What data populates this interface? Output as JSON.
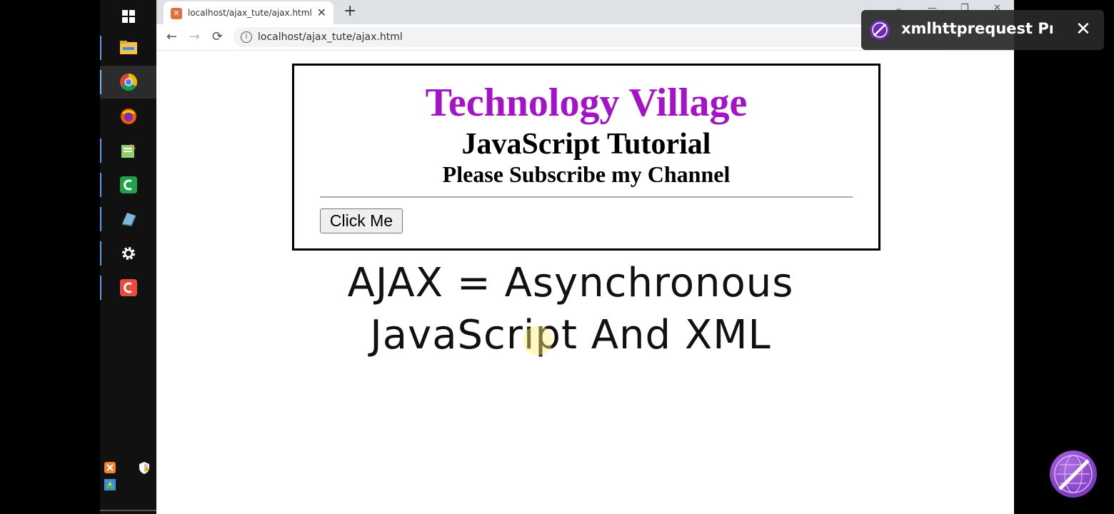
{
  "taskbar": {
    "icons": [
      "windows-icon",
      "file-explorer-icon",
      "chrome-icon",
      "firefox-icon",
      "notepad-icon",
      "camtasia-icon",
      "app-icon",
      "settings-icon",
      "camtasia-red-icon"
    ],
    "tray": [
      "xampp-icon",
      "shield-icon",
      "font-icon"
    ]
  },
  "browser": {
    "tab_title": "localhost/ajax_tute/ajax.html",
    "new_tab": "+",
    "tab_close": "✕",
    "url": "localhost/ajax_tute/ajax.html",
    "back": "←",
    "forward": "→",
    "reload": "⟳"
  },
  "page": {
    "heading1": "Technology Village",
    "heading2": "JavaScript Tutorial",
    "heading3": "Please Subscribe my Channel",
    "button_label": "Click Me",
    "caption_line1": "AJAX = Asynchronous",
    "caption_line2": "JavaScript And XML"
  },
  "overlay": {
    "text": "xmlhttprequest Prop",
    "close": "✕"
  },
  "colors": {
    "heading1": "#a513c9",
    "taskbar_bg": "#111111",
    "overlay_bg": "#282828"
  }
}
